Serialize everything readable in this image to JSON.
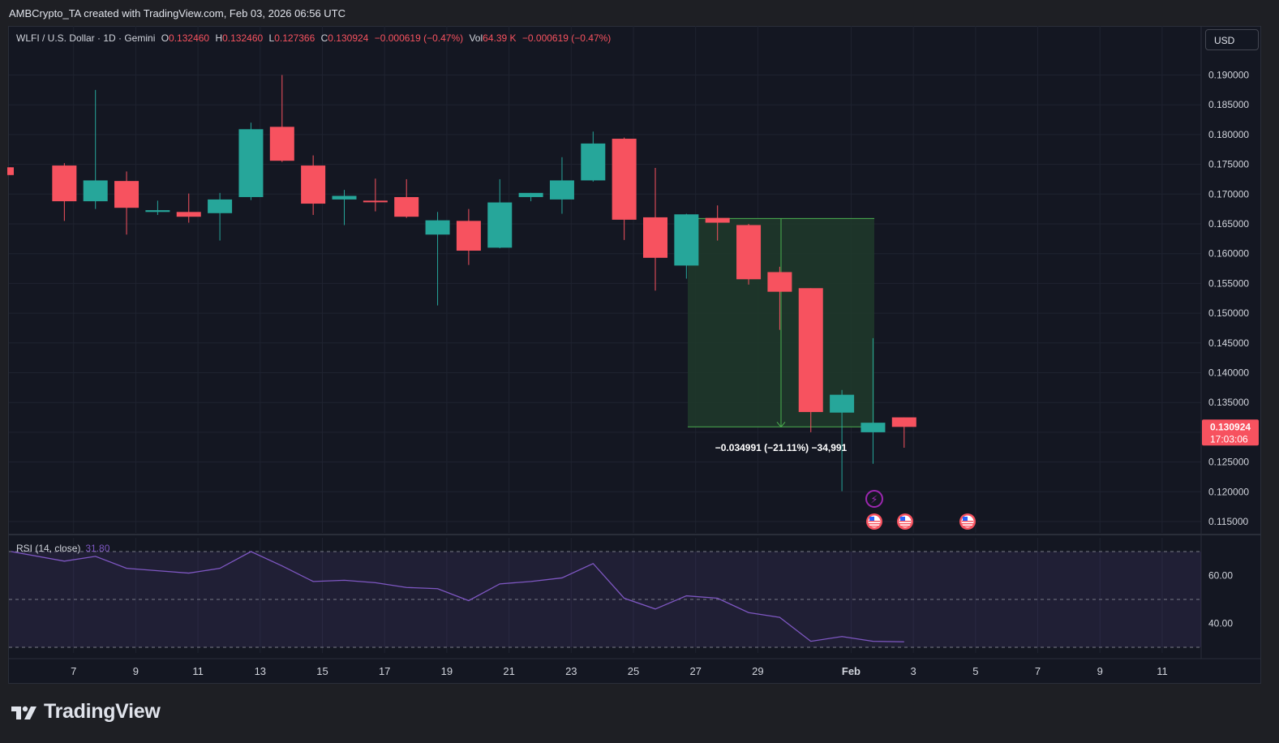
{
  "header": {
    "credit": "AMBCrypto_TA created with TradingView.com, Feb 03, 2026 06:56 UTC"
  },
  "legend": {
    "symbol": "WLFI / U.S. Dollar · 1D · Gemini",
    "o_label": "O",
    "o_value": "0.132460",
    "h_label": "H",
    "h_value": "0.132460",
    "l_label": "L",
    "l_value": "0.127366",
    "c_label": "C",
    "c_value": "0.130924",
    "change": "−0.000619 (−0.47%)",
    "vol_label": "Vol",
    "vol_value": "64.39 K",
    "vol_change": "−0.000619 (−0.47%)"
  },
  "currency_button": "USD",
  "price_badge": {
    "price": "0.130924",
    "countdown": "17:03:06"
  },
  "measure_label": "−0.034991 (−21.11%) −34,991",
  "rsi": {
    "label": "RSI (14, close)",
    "value": "31.80"
  },
  "footer": {
    "brand": "TradingView"
  },
  "colors": {
    "up": "#26a69a",
    "down": "#f7525f",
    "rsi_line": "#7e57c2",
    "measure_fill": "#1e3a2a",
    "measure_border": "#4caf50"
  },
  "chart_data": {
    "type": "candlestick",
    "y_ticks": [
      "0.190000",
      "0.185000",
      "0.180000",
      "0.175000",
      "0.170000",
      "0.165000",
      "0.160000",
      "0.155000",
      "0.150000",
      "0.145000",
      "0.140000",
      "0.135000",
      "0.130000",
      "0.125000",
      "0.120000",
      "0.115000"
    ],
    "x_ticks": [
      "7",
      "9",
      "11",
      "13",
      "15",
      "17",
      "19",
      "21",
      "23",
      "25",
      "27",
      "29",
      "Feb",
      "3",
      "5",
      "7",
      "9",
      "11"
    ],
    "ylim": [
      0.1115,
      0.1935
    ],
    "grid": true,
    "candles": [
      {
        "date": "Jan 5",
        "o": 0.1745,
        "h": 0.1745,
        "l": 0.1732,
        "c": 0.1732
      },
      {
        "date": "Jan 6",
        "o": 0.1748,
        "h": 0.1752,
        "l": 0.1655,
        "c": 0.1688
      },
      {
        "date": "Jan 7",
        "o": 0.1688,
        "h": 0.1875,
        "l": 0.1675,
        "c": 0.1723
      },
      {
        "date": "Jan 8",
        "o": 0.1722,
        "h": 0.1738,
        "l": 0.1632,
        "c": 0.1677
      },
      {
        "date": "Jan 9",
        "o": 0.167,
        "h": 0.1689,
        "l": 0.1665,
        "c": 0.1673
      },
      {
        "date": "Jan 10",
        "o": 0.167,
        "h": 0.1701,
        "l": 0.1652,
        "c": 0.1662
      },
      {
        "date": "Jan 11",
        "o": 0.1668,
        "h": 0.1702,
        "l": 0.1622,
        "c": 0.1691
      },
      {
        "date": "Jan 12",
        "o": 0.1695,
        "h": 0.182,
        "l": 0.169,
        "c": 0.1809
      },
      {
        "date": "Jan 13",
        "o": 0.1813,
        "h": 0.19,
        "l": 0.1754,
        "c": 0.1756
      },
      {
        "date": "Jan 14",
        "o": 0.1748,
        "h": 0.1765,
        "l": 0.1665,
        "c": 0.1684
      },
      {
        "date": "Jan 15",
        "o": 0.1691,
        "h": 0.1707,
        "l": 0.1648,
        "c": 0.1697
      },
      {
        "date": "Jan 16",
        "o": 0.1689,
        "h": 0.1726,
        "l": 0.1671,
        "c": 0.1687
      },
      {
        "date": "Jan 17",
        "o": 0.1695,
        "h": 0.1725,
        "l": 0.166,
        "c": 0.1662
      },
      {
        "date": "Jan 18",
        "o": 0.1632,
        "h": 0.167,
        "l": 0.1513,
        "c": 0.1656
      },
      {
        "date": "Jan 19",
        "o": 0.1655,
        "h": 0.1675,
        "l": 0.1581,
        "c": 0.1605
      },
      {
        "date": "Jan 20",
        "o": 0.161,
        "h": 0.1725,
        "l": 0.1609,
        "c": 0.1686
      },
      {
        "date": "Jan 21",
        "o": 0.1695,
        "h": 0.1702,
        "l": 0.1688,
        "c": 0.1702
      },
      {
        "date": "Jan 22",
        "o": 0.1691,
        "h": 0.1762,
        "l": 0.1667,
        "c": 0.1723
      },
      {
        "date": "Jan 23",
        "o": 0.1723,
        "h": 0.1805,
        "l": 0.1721,
        "c": 0.1785
      },
      {
        "date": "Jan 24",
        "o": 0.1793,
        "h": 0.1795,
        "l": 0.1623,
        "c": 0.1657
      },
      {
        "date": "Jan 25",
        "o": 0.1661,
        "h": 0.1744,
        "l": 0.1538,
        "c": 0.1593
      },
      {
        "date": "Jan 26",
        "o": 0.158,
        "h": 0.1667,
        "l": 0.1558,
        "c": 0.1666
      },
      {
        "date": "Jan 27",
        "o": 0.166,
        "h": 0.1681,
        "l": 0.1622,
        "c": 0.1652
      },
      {
        "date": "Jan 28",
        "o": 0.1648,
        "h": 0.165,
        "l": 0.1548,
        "c": 0.1557
      },
      {
        "date": "Jan 29",
        "o": 0.1569,
        "h": 0.1578,
        "l": 0.1472,
        "c": 0.1536
      },
      {
        "date": "Jan 30",
        "o": 0.1542,
        "h": 0.1542,
        "l": 0.13,
        "c": 0.1334
      },
      {
        "date": "Jan 31",
        "o": 0.1333,
        "h": 0.1371,
        "l": 0.1201,
        "c": 0.1363
      },
      {
        "date": "Feb 1",
        "o": 0.13,
        "h": 0.1458,
        "l": 0.1247,
        "c": 0.1316
      },
      {
        "date": "Feb 2",
        "o": 0.1325,
        "h": 0.1325,
        "l": 0.1274,
        "c": 0.1309
      }
    ],
    "measure": {
      "from_price": 0.1659,
      "to_price": 0.1309,
      "from_date": "Jan 28",
      "to_date": "Feb 2",
      "change": -0.034991,
      "change_pct": -21.11
    },
    "rsi": {
      "ylim": [
        25,
        80
      ],
      "ticks": [
        "60.00",
        "40.00"
      ],
      "bands": [
        70,
        50,
        30
      ],
      "values": [
        70.0,
        66.0,
        68.0,
        63.0,
        62.0,
        61.0,
        63.0,
        70.0,
        64.0,
        57.5,
        58.0,
        57.0,
        55.0,
        54.5,
        49.5,
        56.5,
        57.5,
        59.0,
        65.0,
        50.5,
        46.0,
        51.5,
        50.5,
        44.5,
        42.5,
        32.5,
        34.5,
        32.5,
        32.3
      ]
    }
  }
}
